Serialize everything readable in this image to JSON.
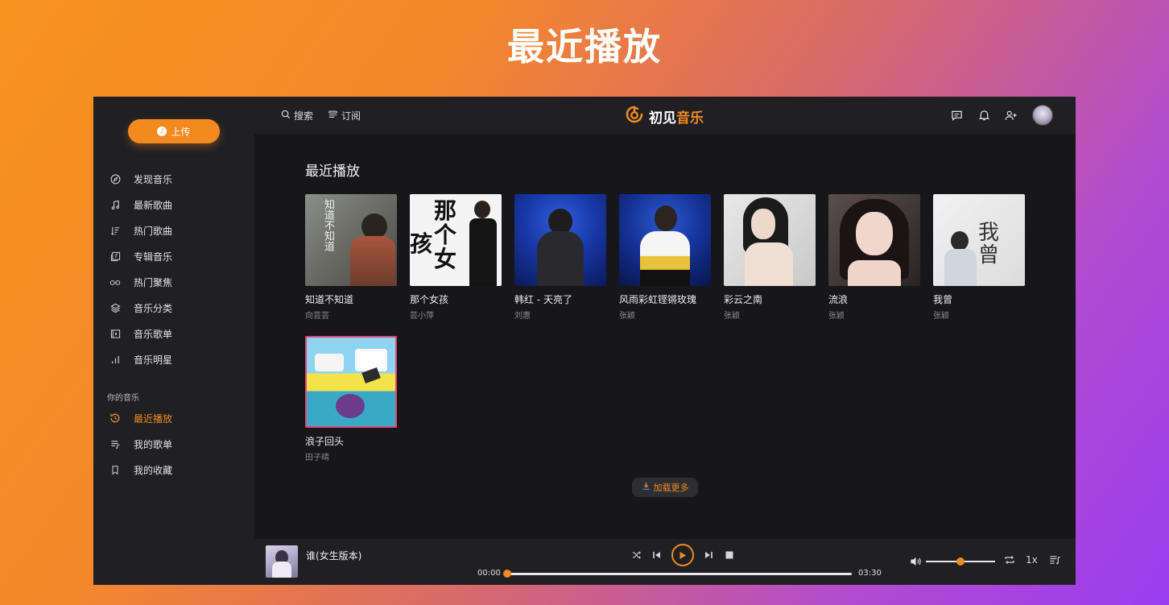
{
  "banner": {
    "title": "最近播放"
  },
  "sidebar": {
    "upload_label": "上传",
    "items": [
      {
        "label": "发现音乐",
        "icon": "compass-icon"
      },
      {
        "label": "最新歌曲",
        "icon": "music-note-icon"
      },
      {
        "label": "热门歌曲",
        "icon": "sort-icon"
      },
      {
        "label": "专辑音乐",
        "icon": "album-icon"
      },
      {
        "label": "热门聚焦",
        "icon": "glasses-icon"
      },
      {
        "label": "音乐分类",
        "icon": "layers-icon"
      },
      {
        "label": "音乐歌单",
        "icon": "playlist-video-icon"
      },
      {
        "label": "音乐明星",
        "icon": "bar-chart-icon"
      }
    ],
    "section_label": "你的音乐",
    "my_items": [
      {
        "label": "最近播放",
        "icon": "history-icon",
        "active": true
      },
      {
        "label": "我的歌单",
        "icon": "playlist-icon",
        "active": false
      },
      {
        "label": "我的收藏",
        "icon": "bookmark-icon",
        "active": false
      }
    ]
  },
  "header": {
    "search_label": "搜索",
    "subscribe_label": "订阅",
    "logo_part1": "初见",
    "logo_part2": "音乐"
  },
  "main": {
    "title": "最近播放",
    "songs": [
      {
        "title": "知道不知道",
        "artist": "向芸芸"
      },
      {
        "title": "那个女孩",
        "artist": "芸小萍"
      },
      {
        "title": "韩红 - 天亮了",
        "artist": "刘惠"
      },
      {
        "title": "风雨彩虹铿锵玫瑰",
        "artist": "张颖"
      },
      {
        "title": "彩云之南",
        "artist": "张颖"
      },
      {
        "title": "流浪",
        "artist": "张颖"
      },
      {
        "title": "我曾",
        "artist": "张颖"
      },
      {
        "title": "浪子回头",
        "artist": "田子晴"
      }
    ],
    "cover_text": {
      "c1": "知道不知道",
      "c2a": "那个",
      "c2b": "女",
      "c2c": "孩",
      "c7": "我曾"
    },
    "load_more": "加载更多"
  },
  "player": {
    "now_title": "谁(女生版本)",
    "current_time": "00:00",
    "total_time": "03:30",
    "progress": 0,
    "volume": 0.5,
    "speed": "1x"
  },
  "colors": {
    "accent": "#f28a1f",
    "bg": "#17171a",
    "panel": "#202023"
  }
}
